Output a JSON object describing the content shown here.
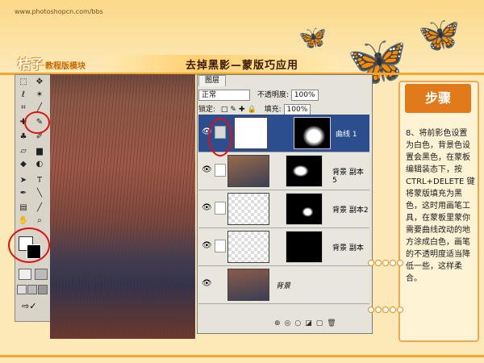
{
  "header": {
    "url": "www.photoshopcn.com/bbs",
    "brand": "桔子",
    "brand_sub": "教程版模块",
    "title": "去掉黑影—蒙版巧应用"
  },
  "layers_panel": {
    "tab": "图层",
    "blend_mode": "正常",
    "opacity_label": "不透明度:",
    "opacity_value": "100%",
    "lock_label": "锁定:",
    "fill_label": "填充:",
    "fill_value": "100%",
    "layers": [
      {
        "name": "曲线 1",
        "active": true
      },
      {
        "name": "背景 副本 5",
        "active": false
      },
      {
        "name": "背景 副本2",
        "active": false
      },
      {
        "name": "背景 副本",
        "active": false
      },
      {
        "name": "背景",
        "active": false
      }
    ]
  },
  "steps": {
    "heading": "步骤",
    "text": "8、将前影色设置为白色，背景色设置会黑色，在蒙板编辑装态下，按 CTRL+DELETE 键将蒙版填充为黑色，这时用画笔工具，在蒙板里蒙你需要曲线改动的地方涂成白色，画笔的不透明度适当降低一些，这样柔合。"
  },
  "colors": {
    "accent": "#f3a630",
    "highlight": "#e01010",
    "layer_active": "#2c4e8f"
  }
}
